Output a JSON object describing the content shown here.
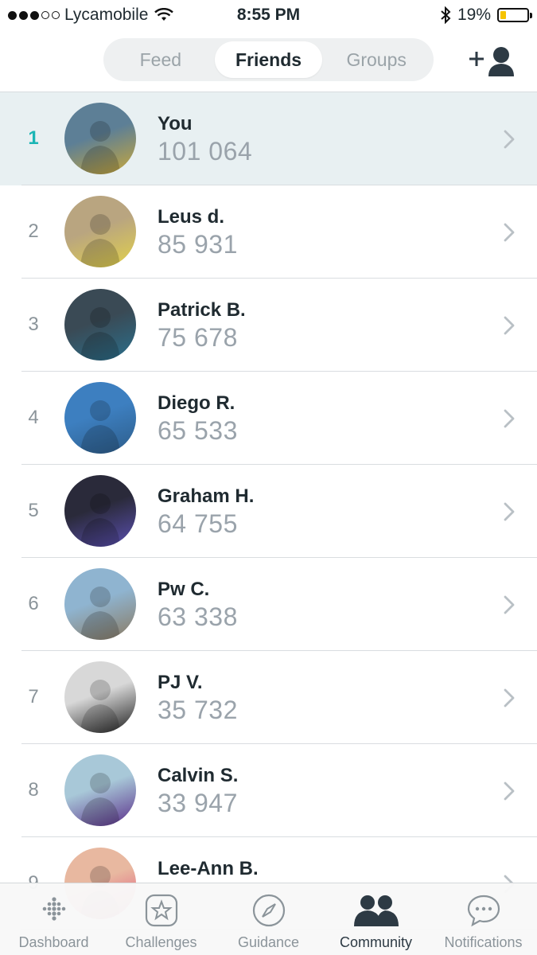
{
  "status_bar": {
    "carrier": "Lycamobile",
    "time": "8:55 PM",
    "battery": "19%",
    "battery_level": 0.19
  },
  "header": {
    "tabs": [
      {
        "label": "Feed",
        "active": false
      },
      {
        "label": "Friends",
        "active": true
      },
      {
        "label": "Groups",
        "active": false
      }
    ],
    "add_friend_icon": "add-person-icon"
  },
  "leaderboard": [
    {
      "rank": "1",
      "name": "You",
      "steps": "101 064",
      "highlight": true,
      "avatar_colors": [
        "#5d7f96",
        "#c9a83a"
      ]
    },
    {
      "rank": "2",
      "name": "Leus d.",
      "steps": "85 931",
      "highlight": false,
      "avatar_colors": [
        "#b9a580",
        "#e2d14a"
      ]
    },
    {
      "rank": "3",
      "name": "Patrick B.",
      "steps": "75 678",
      "highlight": false,
      "avatar_colors": [
        "#3a4a55",
        "#2a6f8c"
      ]
    },
    {
      "rank": "4",
      "name": "Diego R.",
      "steps": "65 533",
      "highlight": false,
      "avatar_colors": [
        "#3d7fc0",
        "#2d5d8a"
      ]
    },
    {
      "rank": "5",
      "name": "Graham H.",
      "steps": "64 755",
      "highlight": false,
      "avatar_colors": [
        "#2a2a3a",
        "#5a4fb0"
      ]
    },
    {
      "rank": "6",
      "name": "Pw C.",
      "steps": "63 338",
      "highlight": false,
      "avatar_colors": [
        "#8fb4d0",
        "#8a7a62"
      ]
    },
    {
      "rank": "7",
      "name": "PJ V.",
      "steps": "35 732",
      "highlight": false,
      "avatar_colors": [
        "#d8d8d8",
        "#1e1e1e"
      ]
    },
    {
      "rank": "8",
      "name": "Calvin S.",
      "steps": "33 947",
      "highlight": false,
      "avatar_colors": [
        "#a8c8d8",
        "#5a2e8a"
      ]
    },
    {
      "rank": "9",
      "name": "Lee-Ann B.",
      "steps": "",
      "highlight": false,
      "avatar_colors": [
        "#e8b8a0",
        "#e04b7a"
      ]
    }
  ],
  "tabbar": {
    "items": [
      {
        "label": "Dashboard",
        "icon": "dots-grid-icon",
        "active": false
      },
      {
        "label": "Challenges",
        "icon": "star-badge-icon",
        "active": false
      },
      {
        "label": "Guidance",
        "icon": "compass-icon",
        "active": false
      },
      {
        "label": "Community",
        "icon": "people-icon",
        "active": true
      },
      {
        "label": "Notifications",
        "icon": "chat-bubble-icon",
        "active": false
      }
    ]
  },
  "colors": {
    "accent": "#1ab5b5",
    "highlight_row": "#e8f0f2",
    "muted_text": "#9aa3ab"
  }
}
